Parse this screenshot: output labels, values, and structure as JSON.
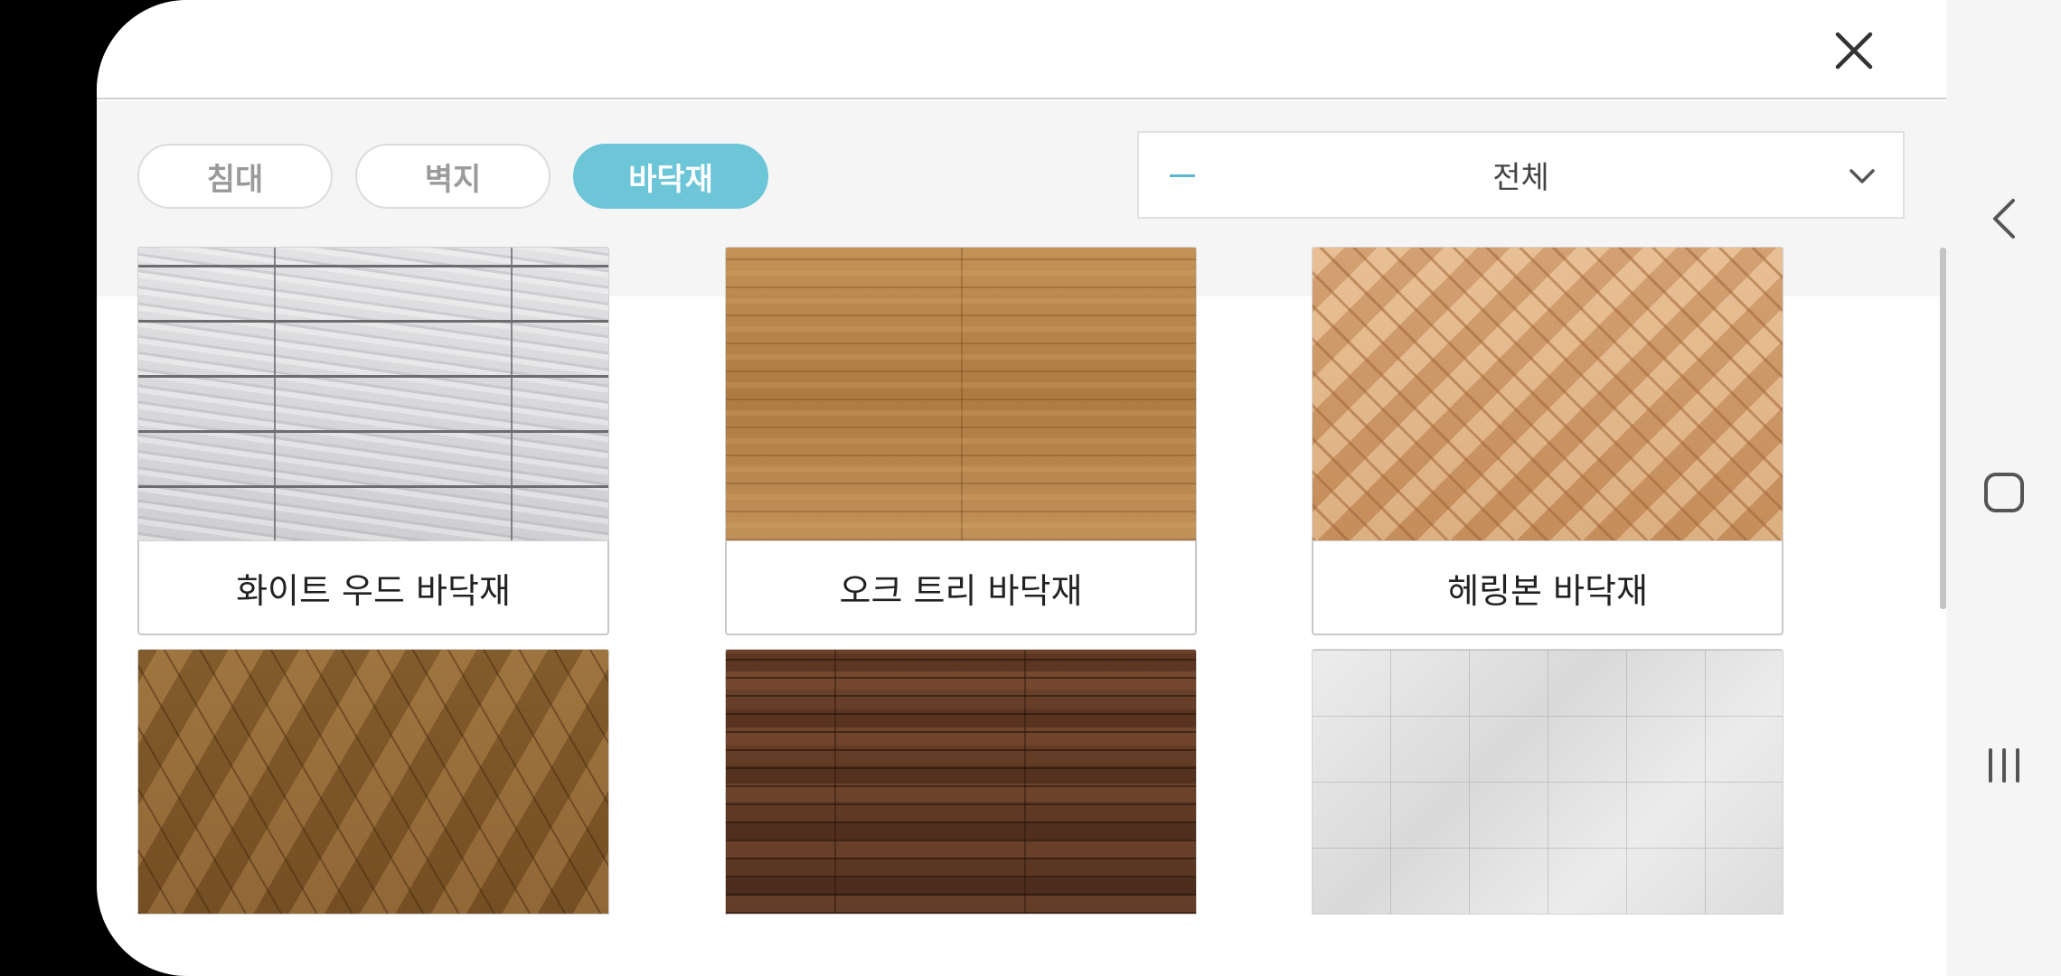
{
  "header": {
    "close_label": "close"
  },
  "filters": {
    "tabs": [
      {
        "label": "침대",
        "active": false
      },
      {
        "label": "벽지",
        "active": false
      },
      {
        "label": "바닥재",
        "active": true
      }
    ]
  },
  "dropdown": {
    "selected": "전체"
  },
  "products": [
    {
      "label": "화이트 우드 바닥재",
      "texture": "white-wood"
    },
    {
      "label": "오크 트리 바닥재",
      "texture": "oak"
    },
    {
      "label": "헤링본 바닥재",
      "texture": "herringbone"
    },
    {
      "label": "",
      "texture": "chevron"
    },
    {
      "label": "",
      "texture": "dark-wood"
    },
    {
      "label": "",
      "texture": "marble"
    }
  ],
  "colors": {
    "accent": "#6cc6d8",
    "border": "#c8c8c8",
    "band": "#f5f5f5"
  },
  "icons": [
    "close-icon",
    "chevron-down-icon",
    "back-icon",
    "home-icon",
    "recents-icon"
  ]
}
